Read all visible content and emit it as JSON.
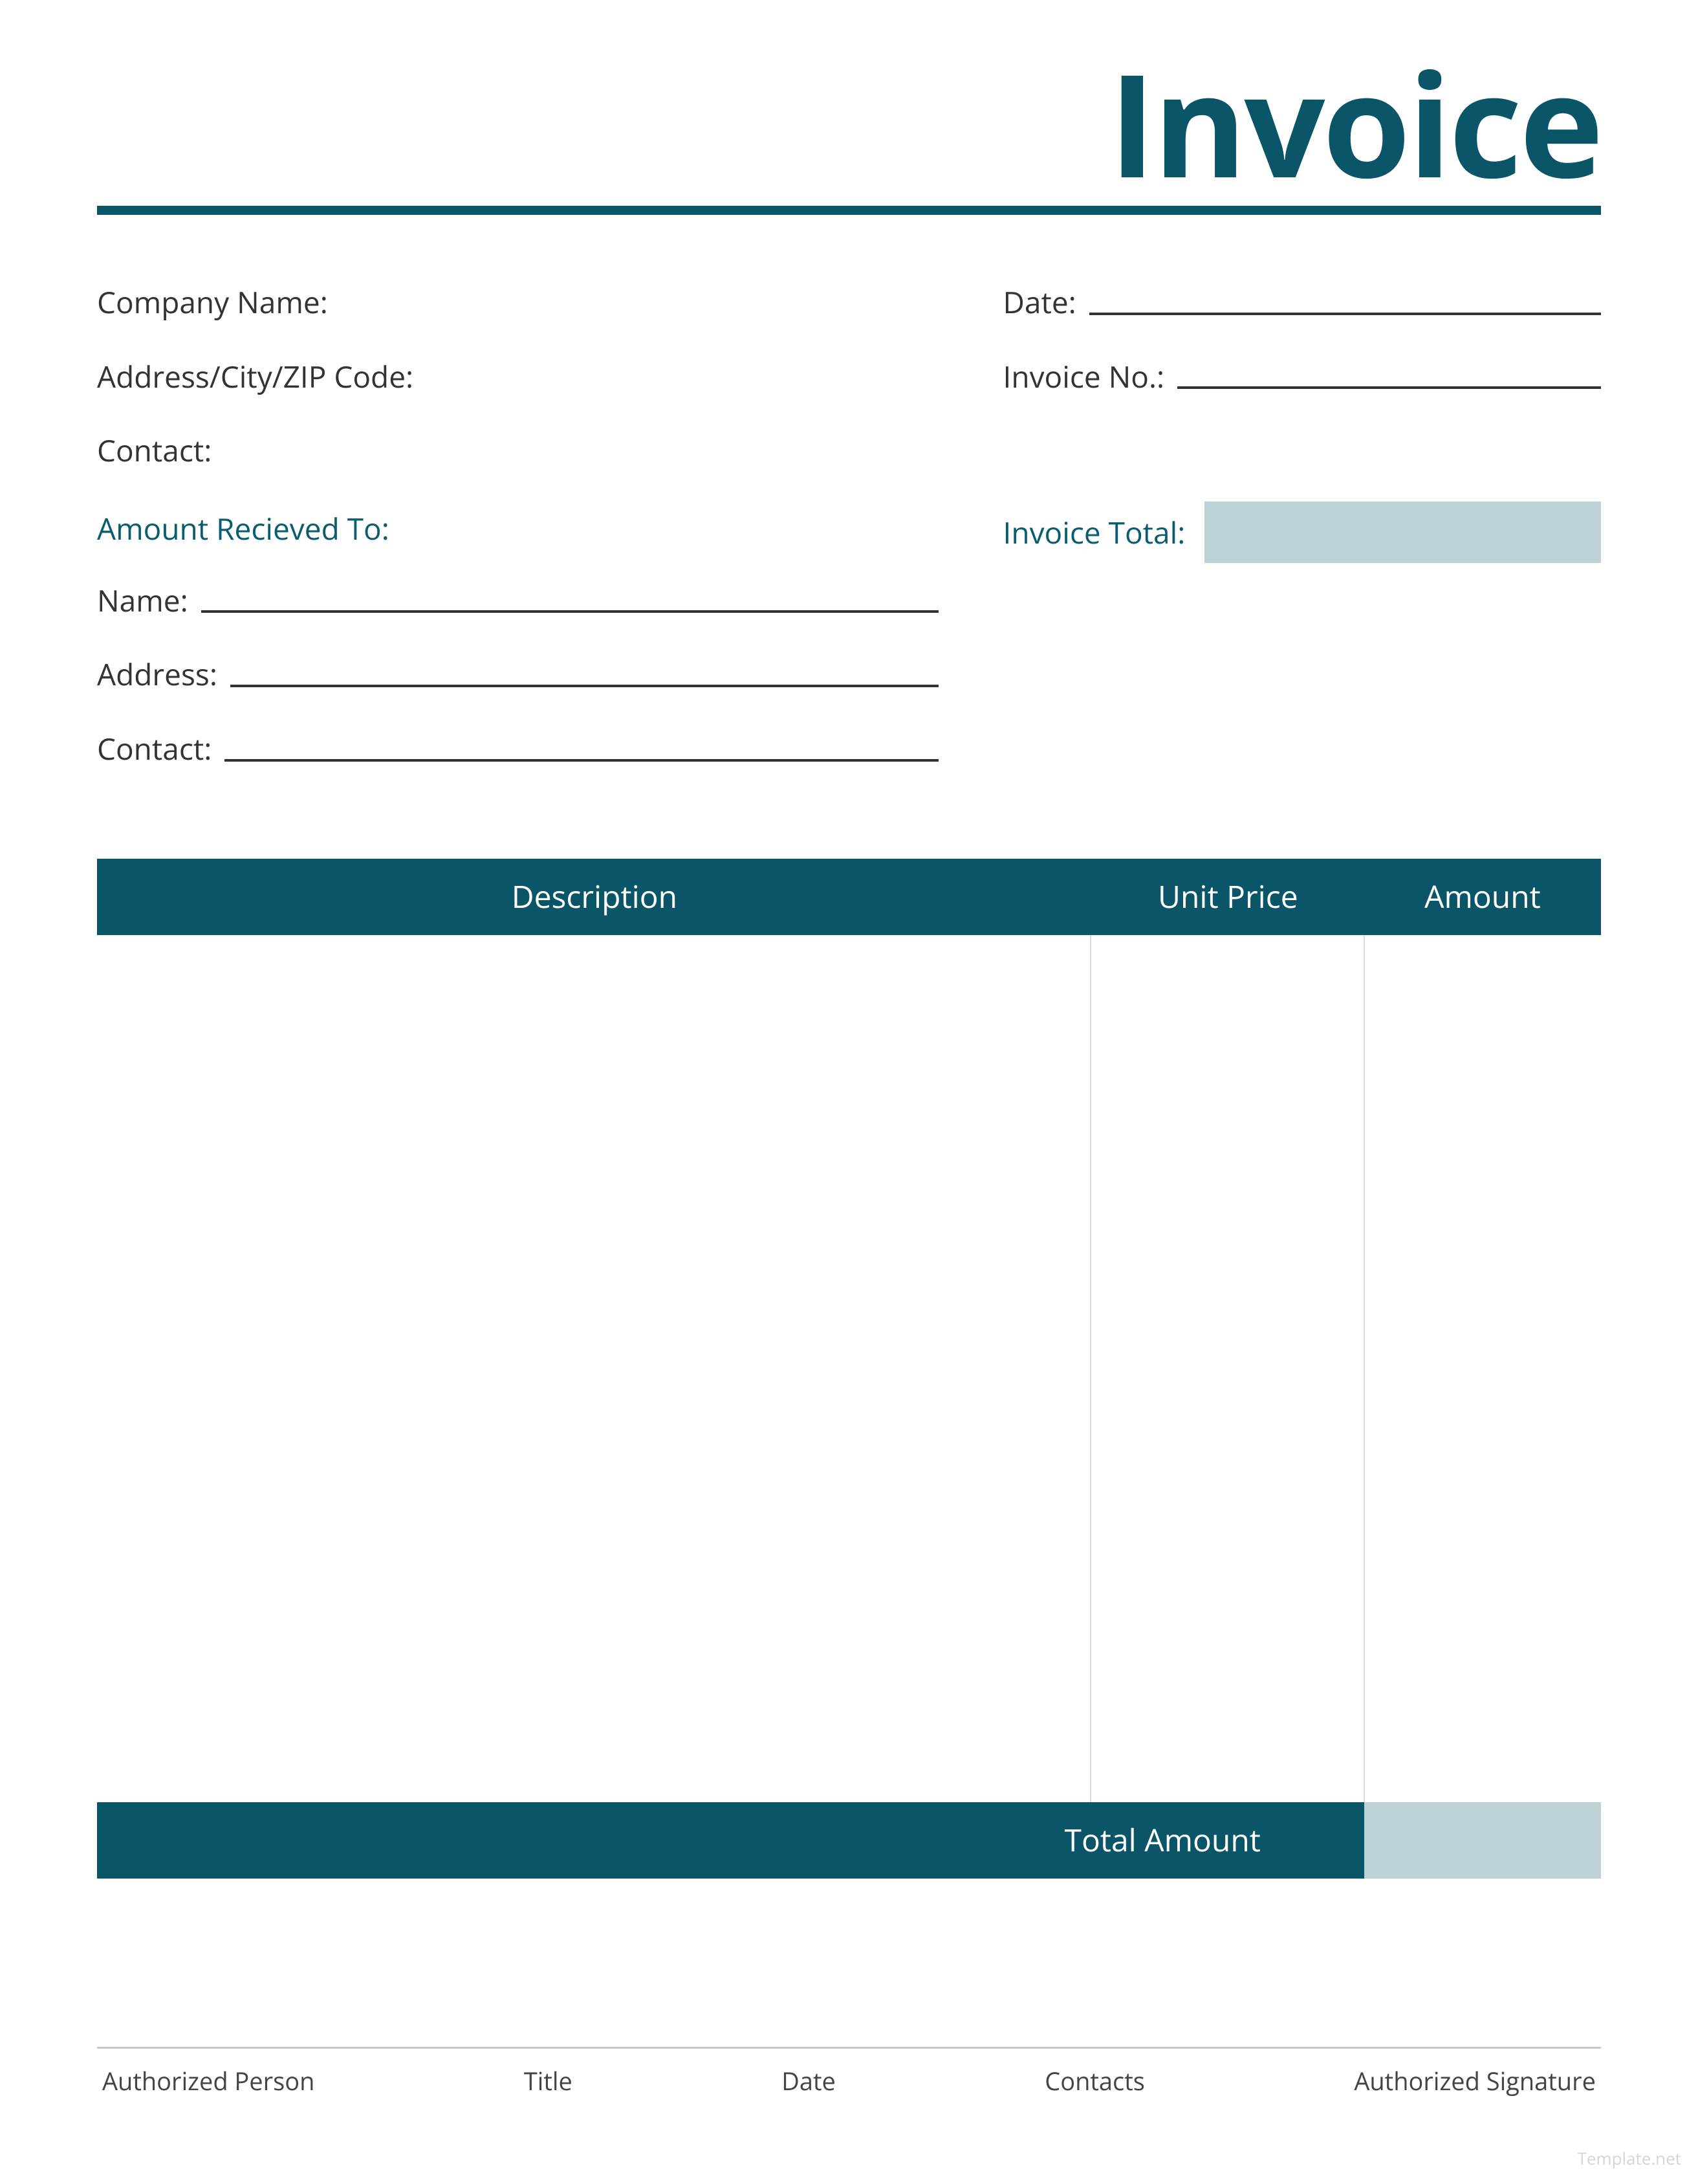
{
  "colors": {
    "primary": "#0a5567",
    "accentLight": "#bcd2d5"
  },
  "title": "Invoice",
  "header": {
    "left": {
      "companyName": "Company Name:",
      "address": "Address/City/ZIP Code:",
      "contact": "Contact:"
    },
    "right": {
      "date": "Date:",
      "invoiceNo": "Invoice No.:"
    }
  },
  "received": {
    "heading": "Amount Recieved To:",
    "name": "Name:",
    "address": "Address:",
    "contact": "Contact:"
  },
  "invoiceTotal": {
    "label": "Invoice Total:",
    "value": ""
  },
  "table": {
    "columns": {
      "description": "Description",
      "unitPrice": "Unit Price",
      "amount": "Amount"
    },
    "footer": {
      "totalAmountLabel": "Total Amount",
      "totalAmountValue": ""
    }
  },
  "signatures": {
    "authorizedPerson": "Authorized Person",
    "title": "Title",
    "date": "Date",
    "contacts": "Contacts",
    "authorizedSignature": "Authorized Signature"
  },
  "watermark": "Template.net"
}
